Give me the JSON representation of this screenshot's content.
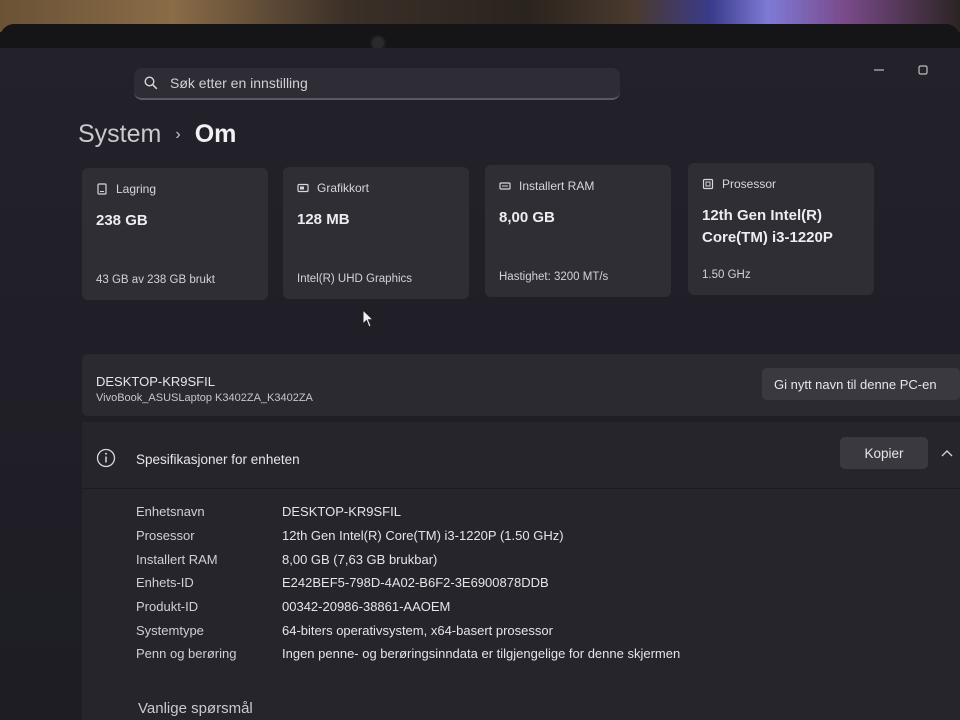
{
  "search": {
    "placeholder": "Søk etter en innstilling"
  },
  "breadcrumb": {
    "parent": "System",
    "separator": "›",
    "current": "Om"
  },
  "cards": [
    {
      "icon": "storage-icon",
      "title": "Lagring",
      "value": "238 GB",
      "sub": "43 GB av 238 GB brukt"
    },
    {
      "icon": "graphics-card-icon",
      "title": "Grafikkort",
      "value": "128 MB",
      "sub": "Intel(R) UHD Graphics"
    },
    {
      "icon": "ram-icon",
      "title": "Installert RAM",
      "value": "8,00 GB",
      "sub": "Hastighet: 3200 MT/s"
    },
    {
      "icon": "processor-icon",
      "title": "Prosessor",
      "value_line1": "12th Gen Intel(R)",
      "value_line2": "Core(TM) i3-1220P",
      "sub": "1.50 GHz"
    }
  ],
  "device": {
    "name": "DESKTOP-KR9SFIL",
    "model": "VivoBook_ASUSLaptop K3402ZA_K3402ZA",
    "rename_label": "Gi nytt navn til denne PC-en"
  },
  "specs": {
    "title": "Spesifikasjoner for enheten",
    "copy_label": "Kopier",
    "rows": [
      {
        "label": "Enhetsnavn",
        "value": "DESKTOP-KR9SFIL"
      },
      {
        "label": "Prosessor",
        "value": "12th Gen Intel(R) Core(TM) i3-1220P (1.50 GHz)"
      },
      {
        "label": "Installert RAM",
        "value": "8,00 GB (7,63 GB brukbar)"
      },
      {
        "label": "Enhets-ID",
        "value": "E242BEF5-798D-4A02-B6F2-3E6900878DDB"
      },
      {
        "label": "Produkt-ID",
        "value": "00342-20986-38861-AAOEM"
      },
      {
        "label": "Systemtype",
        "value": "64-biters operativsystem, x64-basert prosessor"
      },
      {
        "label": "Penn og berøring",
        "value": "Ingen penne- og berøringsinndata er tilgjengelige for denne skjermen"
      }
    ]
  },
  "faq_title": "Vanlige spørsmål",
  "colors": {
    "background": "#201f27",
    "card": "#2f2e35",
    "button": "#3a3940",
    "text": "#e6e6ea"
  }
}
